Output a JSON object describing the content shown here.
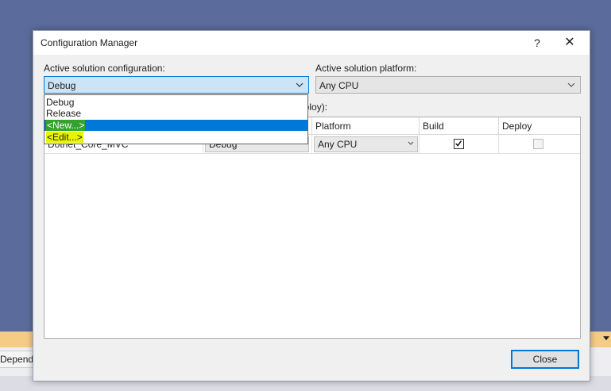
{
  "background": {
    "tab_label": "Depende"
  },
  "dialog": {
    "title": "Configuration Manager",
    "help_label": "?",
    "close_label": "✕",
    "active_config_label": "Active solution configuration:",
    "active_config_value": "Debug",
    "active_platform_label": "Active solution platform:",
    "active_platform_value": "Any CPU",
    "project_contexts_label_partial": "eploy):",
    "close_button_label": "Close"
  },
  "dropdown": {
    "items": [
      "Debug",
      "Release",
      "<New...>",
      "<Edit...>"
    ],
    "selected_index": 2
  },
  "grid": {
    "columns": [
      "Platform",
      "Build",
      "Deploy"
    ],
    "rows": [
      {
        "project": "Dotnet_Core_MVC",
        "configuration": "Debug",
        "platform": "Any CPU",
        "build": true,
        "deploy": false
      }
    ]
  },
  "colors": {
    "accent": "#0078d7",
    "highlight_yellow": "#e9f500",
    "highlight_green": "#35a12e",
    "desktop": "#5b6c9c"
  }
}
